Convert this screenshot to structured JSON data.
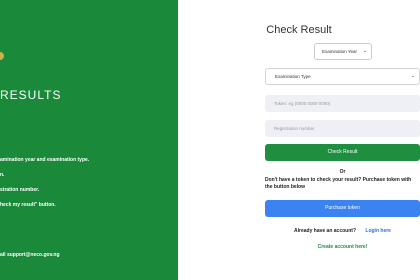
{
  "left": {
    "heading": "RESULTS",
    "instructions": [
      "amination year and examination type.",
      "n.",
      "stration number.",
      "heck my result\" button."
    ],
    "support": "ail support@neco.gov.ng"
  },
  "form": {
    "title": "Check Result",
    "year_select": "Examination Year",
    "type_select": "Examination Type",
    "token_placeholder": "Token: eg (0000 0000 0000)",
    "registration_placeholder": "Registration number",
    "check_button": "Check Result",
    "or": "Or",
    "note": "Don't have a token to check your result? Purchase token with the button below",
    "purchase_button": "Purchase token",
    "account_question": "Already have an account?",
    "login_link": "Login here",
    "create_link": "Create account here!"
  },
  "colors": {
    "left_panel": "#1a8a3a",
    "check_button": "#1f8f3f",
    "purchase_button": "#3a83f1",
    "login_link": "#2f6fde"
  },
  "icons": {
    "dropdown": "chevron-down-icon"
  }
}
